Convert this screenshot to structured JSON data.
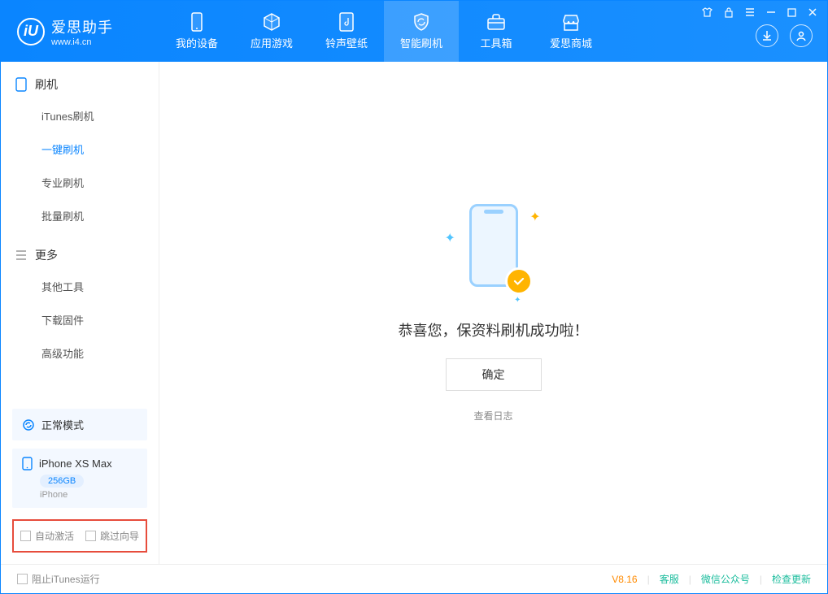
{
  "app": {
    "logo_letter": "iU",
    "title": "爱思助手",
    "subtitle": "www.i4.cn"
  },
  "nav": {
    "tabs": [
      {
        "label": "我的设备"
      },
      {
        "label": "应用游戏"
      },
      {
        "label": "铃声壁纸"
      },
      {
        "label": "智能刷机"
      },
      {
        "label": "工具箱"
      },
      {
        "label": "爱思商城"
      }
    ]
  },
  "sidebar": {
    "group1_title": "刷机",
    "group1": [
      {
        "label": "iTunes刷机"
      },
      {
        "label": "一键刷机"
      },
      {
        "label": "专业刷机"
      },
      {
        "label": "批量刷机"
      }
    ],
    "group2_title": "更多",
    "group2": [
      {
        "label": "其他工具"
      },
      {
        "label": "下载固件"
      },
      {
        "label": "高级功能"
      }
    ],
    "status_mode": "正常模式",
    "device": {
      "name": "iPhone XS Max",
      "capacity": "256GB",
      "type": "iPhone"
    },
    "cb_auto_activate": "自动激活",
    "cb_skip_guide": "跳过向导"
  },
  "main": {
    "success_text": "恭喜您，保资料刷机成功啦！",
    "ok_label": "确定",
    "view_log": "查看日志"
  },
  "statusbar": {
    "block_itunes": "阻止iTunes运行",
    "version": "V8.16",
    "support": "客服",
    "wechat": "微信公众号",
    "update": "检查更新"
  }
}
